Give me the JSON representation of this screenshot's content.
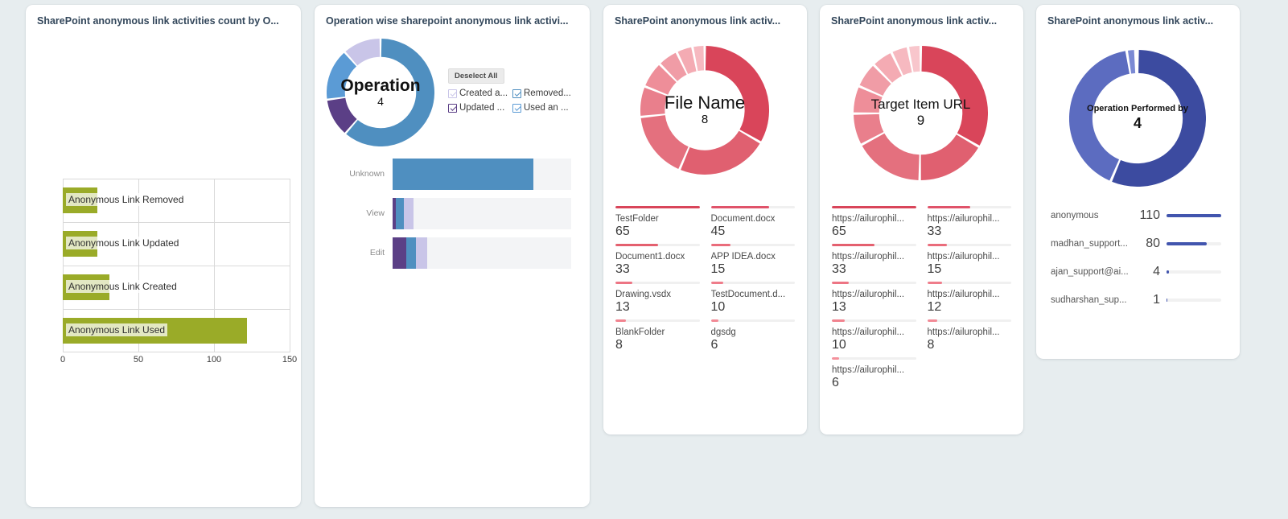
{
  "page": {
    "background": "#e7edef"
  },
  "cards": {
    "bar": {
      "title": "SharePoint anonymous link activities count by O..."
    },
    "operation": {
      "title": "Operation wise sharepoint anonymous link activi..."
    },
    "file": {
      "title": "SharePoint anonymous link activ..."
    },
    "url": {
      "title": "SharePoint anonymous link activ..."
    },
    "performer": {
      "title": "SharePoint anonymous link activ..."
    }
  },
  "operation_legend": {
    "deselect_label": "Deselect All",
    "items": [
      {
        "label": "Created a...",
        "color": "#c9c5e8",
        "checked": true
      },
      {
        "label": "Removed...",
        "color": "#4f8fc0",
        "checked": true
      },
      {
        "label": "Updated ...",
        "color": "#5b3f86",
        "checked": true
      },
      {
        "label": "Used an ...",
        "color": "#5b9bd5",
        "checked": true
      }
    ]
  },
  "chart_data": [
    {
      "id": "anonymous-link-activities-bar",
      "type": "bar",
      "orientation": "horizontal",
      "title": "SharePoint anonymous link activities count by O...",
      "categories": [
        "Anonymous Link Removed",
        "Anonymous Link Updated",
        "Anonymous Link Created",
        "Anonymous Link Used"
      ],
      "values": [
        23,
        23,
        31,
        122
      ],
      "color": "#9aab28",
      "xlabel": "",
      "ylabel": "",
      "xlim": [
        0,
        150
      ],
      "xticks": [
        0,
        50,
        100,
        150
      ],
      "xtick_labels": [
        "0",
        "50",
        "100",
        "150"
      ],
      "grid": true
    },
    {
      "id": "operation-donut",
      "type": "pie",
      "subtype": "donut",
      "center_title": "Operation",
      "center_count": "4",
      "labels": [
        "Used an anonymous link",
        "Removed an anonymous link",
        "Created an anonymous link",
        "Updated an anonymous link"
      ],
      "values": [
        122,
        23,
        31,
        23
      ],
      "colors": [
        "#4f8fc0",
        "#5b3f86",
        "#5b9bd5",
        "#c9c5e8"
      ],
      "legend_position": "right"
    },
    {
      "id": "operation-wise-stacked",
      "type": "bar",
      "subtype": "stacked",
      "orientation": "horizontal",
      "categories": [
        "Unknown",
        "View",
        "Edit"
      ],
      "series": [
        {
          "name": "Updated an anonymous link",
          "color": "#5b3f86",
          "values": [
            0,
            3,
            12
          ]
        },
        {
          "name": "Removed an anonymous link",
          "color": "#4f8fc0",
          "values": [
            0,
            7,
            8
          ]
        },
        {
          "name": "Created an anonymous link",
          "color": "#c9c5e8",
          "values": [
            0,
            8,
            10
          ]
        },
        {
          "name": "Used an anonymous link",
          "color": "#4f8fc0",
          "values": [
            122,
            0,
            0
          ]
        }
      ],
      "track_color": "#f3f4f6"
    },
    {
      "id": "file-name-donut",
      "type": "pie",
      "subtype": "donut",
      "center_title": "File Name",
      "center_count": "8",
      "labels": [
        "TestFolder",
        "Document.docx",
        "Document1.docx",
        "APP IDEA.docx",
        "Drawing.vsdx",
        "TestDocument.d...",
        "BlankFolder",
        "dgsdg"
      ],
      "values": [
        65,
        45,
        33,
        15,
        13,
        10,
        8,
        6
      ],
      "colors": [
        "#d9455a",
        "#e06070",
        "#e4707e",
        "#e97f8c",
        "#ee8e99",
        "#f09ca6",
        "#f4abb3",
        "#f6b9c0"
      ]
    },
    {
      "id": "target-item-url-donut",
      "type": "pie",
      "subtype": "donut",
      "center_title": "Target Item URL",
      "center_count": "9",
      "labels": [
        "https://ailurophil...",
        "https://ailurophil...",
        "https://ailurophil...",
        "https://ailurophil...",
        "https://ailurophil...",
        "https://ailurophil...",
        "https://ailurophil...",
        "https://ailurophil...",
        "https://ailurophil..."
      ],
      "values": [
        65,
        33,
        33,
        15,
        13,
        12,
        10,
        8,
        6
      ],
      "colors": [
        "#d9455a",
        "#e06070",
        "#e4707e",
        "#e97f8c",
        "#ee8e99",
        "#f09ca6",
        "#f4abb3",
        "#f6b9c0",
        "#f8c6cc"
      ]
    },
    {
      "id": "operation-performed-by-donut",
      "type": "pie",
      "subtype": "donut",
      "center_title": "Operation Performed by",
      "center_count": "4",
      "labels": [
        "anonymous",
        "madhan_support...",
        "ajan_support@ai...",
        "sudharshan_sup..."
      ],
      "values": [
        110,
        80,
        4,
        1
      ],
      "colors": [
        "#3c4ba0",
        "#5c6cc0",
        "#7b8ad4",
        "#aab4e4"
      ]
    }
  ],
  "file_tiles": {
    "max": 65,
    "items": [
      {
        "label": "TestFolder",
        "value": "65",
        "pct": 100,
        "color": "#d9455a"
      },
      {
        "label": "Document.docx",
        "value": "45",
        "pct": 69,
        "color": "#e0536a"
      },
      {
        "label": "Document1.docx",
        "value": "33",
        "pct": 51,
        "color": "#e4606f"
      },
      {
        "label": "APP IDEA.docx",
        "value": "15",
        "pct": 23,
        "color": "#ea6c7b"
      },
      {
        "label": "Drawing.vsdx",
        "value": "13",
        "pct": 20,
        "color": "#ed7584"
      },
      {
        "label": "TestDocument.d...",
        "value": "10",
        "pct": 15,
        "color": "#ef7d8b"
      },
      {
        "label": "BlankFolder",
        "value": "8",
        "pct": 12,
        "color": "#f1838f"
      },
      {
        "label": "dgsdg",
        "value": "6",
        "pct": 9,
        "color": "#f28a96"
      }
    ]
  },
  "url_tiles": {
    "max": 65,
    "items": [
      {
        "label": "https://ailurophil...",
        "value": "65",
        "pct": 100,
        "color": "#d9455a"
      },
      {
        "label": "https://ailurophil...",
        "value": "33",
        "pct": 51,
        "color": "#e0536a"
      },
      {
        "label": "https://ailurophil...",
        "value": "33",
        "pct": 51,
        "color": "#e4606f"
      },
      {
        "label": "https://ailurophil...",
        "value": "15",
        "pct": 23,
        "color": "#ea6c7b"
      },
      {
        "label": "https://ailurophil...",
        "value": "13",
        "pct": 20,
        "color": "#ed7584"
      },
      {
        "label": "https://ailurophil...",
        "value": "12",
        "pct": 18,
        "color": "#ef7d8b"
      },
      {
        "label": "https://ailurophil...",
        "value": "10",
        "pct": 15,
        "color": "#f1838f"
      },
      {
        "label": "https://ailurophil...",
        "value": "8",
        "pct": 12,
        "color": "#f28a96"
      },
      {
        "label": "https://ailurophil...",
        "value": "6",
        "pct": 9,
        "color": "#f4919c"
      }
    ]
  },
  "performer_list": {
    "max": 110,
    "accent": "#4255ae",
    "items": [
      {
        "name": "anonymous",
        "value": "110",
        "pct": 100
      },
      {
        "name": "madhan_support...",
        "value": "80",
        "pct": 73
      },
      {
        "name": "ajan_support@ai...",
        "value": "4",
        "pct": 4
      },
      {
        "name": "sudharshan_sup...",
        "value": "1",
        "pct": 2
      }
    ]
  }
}
